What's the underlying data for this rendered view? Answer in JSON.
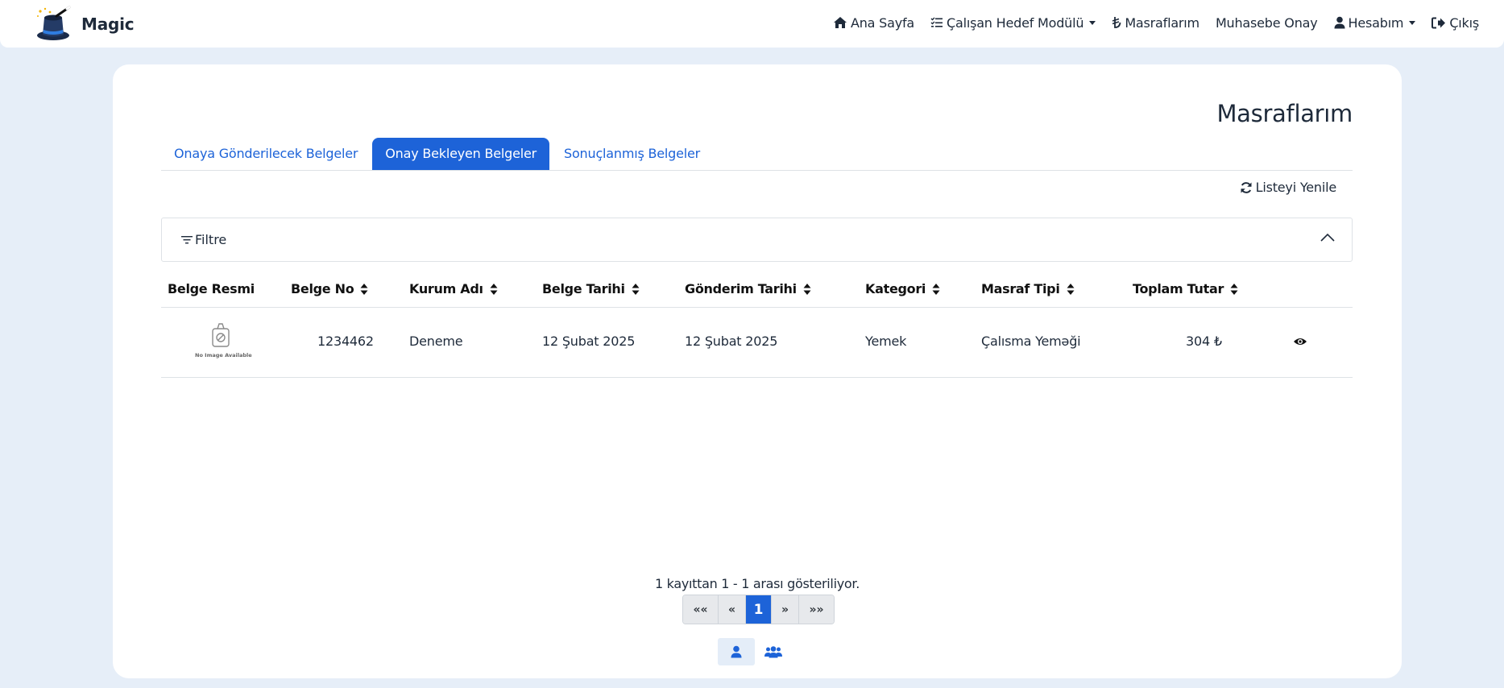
{
  "navbar": {
    "brand": "Magic",
    "items": [
      {
        "label": "Ana Sayfa",
        "icon": "home-icon"
      },
      {
        "label": "Çalışan Hedef Modülü",
        "icon": "list-check-icon",
        "dropdown": true
      },
      {
        "label": "Masraflarım",
        "icon": "lira-icon"
      },
      {
        "label": "Muhasebe Onay"
      },
      {
        "label": "Hesabım",
        "icon": "user-icon",
        "dropdown": true
      },
      {
        "label": "Çıkış",
        "icon": "logout-icon"
      }
    ]
  },
  "page": {
    "title": "Masraflarım",
    "tabs": [
      {
        "label": "Onaya Gönderilecek Belgeler",
        "active": false
      },
      {
        "label": "Onay Bekleyen Belgeler",
        "active": true
      },
      {
        "label": "Sonuçlanmış Belgeler",
        "active": false
      }
    ],
    "refresh_label": "Listeyi Yenile",
    "filter_label": "Filtre"
  },
  "table": {
    "columns": [
      "Belge Resmi",
      "Belge No",
      "Kurum Adı",
      "Belge Tarihi",
      "Gönderim Tarihi",
      "Kategori",
      "Masraf Tipi",
      "Toplam Tutar"
    ],
    "rows": [
      {
        "image_text": "No Image Available",
        "belge_no": "1234462",
        "kurum_adi": "Deneme",
        "belge_tarihi": "12 Şubat 2025",
        "gonderim_tarihi": "12 Şubat 2025",
        "kategori": "Yemek",
        "masraf_tipi": "Çalısma Yeməği",
        "toplam_tutar": "304 ₺"
      }
    ]
  },
  "pagination": {
    "info": "1 kayıttan 1 - 1 arası gösteriliyor.",
    "first": "««",
    "prev": "«",
    "current": "1",
    "next": "»",
    "last": "»»"
  },
  "colors": {
    "primary": "#1d63d8",
    "background": "#e6eef8",
    "text": "#1e2a3a"
  }
}
